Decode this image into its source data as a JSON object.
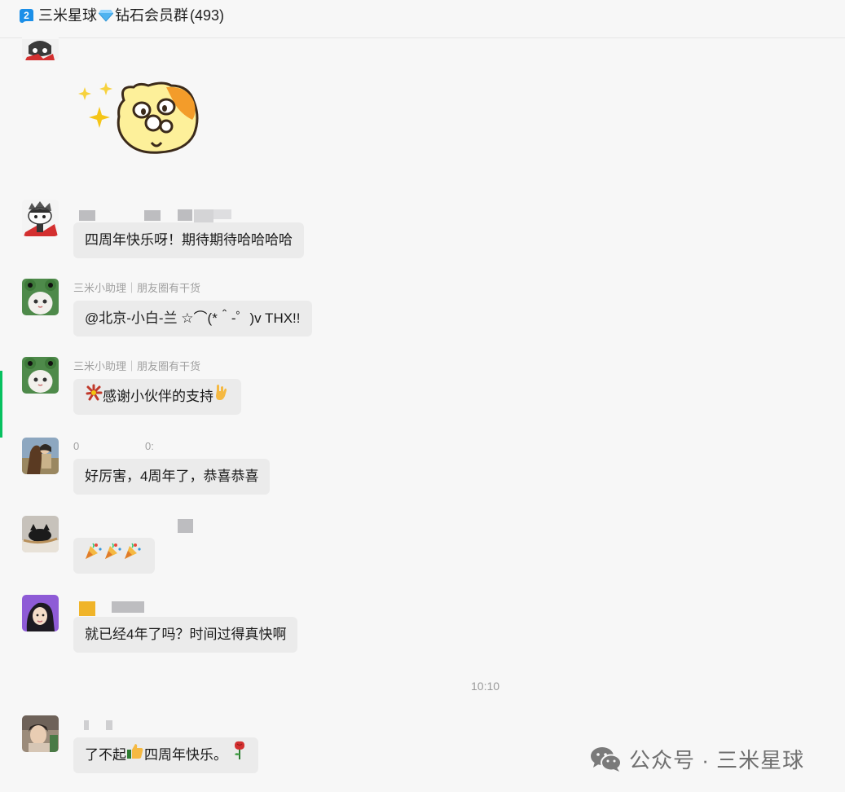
{
  "header": {
    "badge": "2",
    "title_prefix": "三米星球",
    "title_suffix": "钻石会员群",
    "member_count": "(493)"
  },
  "messages": [
    {
      "sender": "",
      "text": "四周年快乐呀！期待期待哈哈哈哈"
    },
    {
      "sender": "三米小助理｜朋友圈有干货",
      "text": "@北京-小白-兰 ☆⌒(*＾-゜)v THX!!"
    },
    {
      "sender": "三米小助理｜朋友圈有干货",
      "text": "感谢小伙伴的支持"
    },
    {
      "sender_a": "0",
      "sender_b": "0:",
      "text": "好厉害，4周年了，恭喜恭喜"
    },
    {
      "sender": "",
      "text": ""
    },
    {
      "sender": "",
      "text": "就已经4年了吗？时间过得真快啊"
    },
    {
      "sender": "",
      "text_a": "了不起",
      "text_b": "四周年快乐。"
    }
  ],
  "timestamp": "10:10",
  "watermark": {
    "label": "公众号 · 三米星球"
  }
}
